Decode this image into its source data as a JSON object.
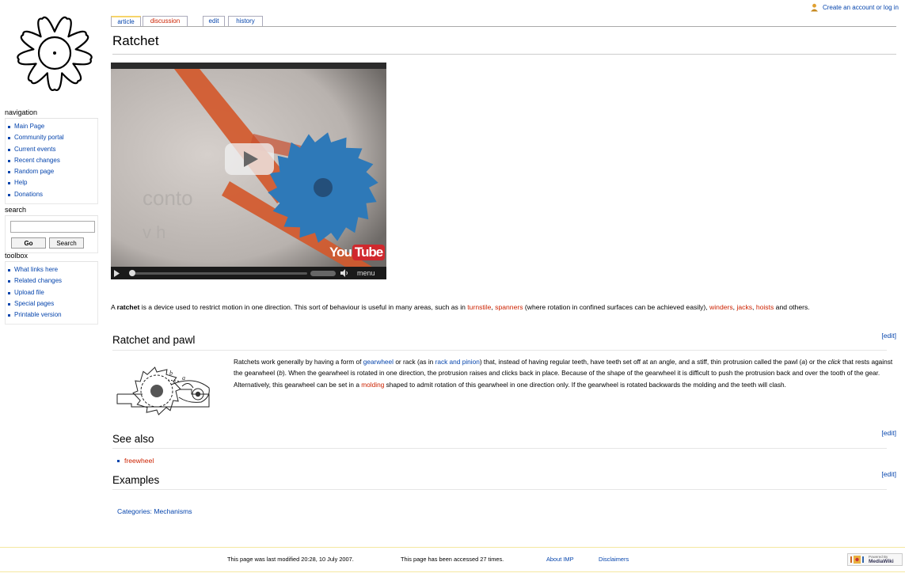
{
  "personal": {
    "login_label": "Create an account or log in"
  },
  "tabs": {
    "article": "article",
    "discussion": "discussion",
    "edit": "edit",
    "history": "history"
  },
  "sidebar": {
    "navigation": {
      "heading": "navigation",
      "items": [
        "Main Page",
        "Community portal",
        "Current events",
        "Recent changes",
        "Random page",
        "Help",
        "Donations"
      ]
    },
    "search": {
      "heading": "search",
      "value": "",
      "go_label": "Go",
      "search_label": "Search"
    },
    "toolbox": {
      "heading": "toolbox",
      "items": [
        "What links here",
        "Related changes",
        "Upload file",
        "Special pages",
        "Printable version"
      ]
    }
  },
  "content": {
    "title": "Ratchet",
    "video": {
      "brand_you": "You",
      "brand_tube": "Tube",
      "menu_label": "menu"
    },
    "intro": {
      "lead": "A ",
      "bold": "ratchet",
      "rest": " is a device used to restrict motion in one direction. This sort of behaviour is useful in many areas, such as in ",
      "link_turnstile": "turnstile",
      "sep1": ", ",
      "link_spanners": "spanners",
      "mid": " (where rotation in confined surfaces can be achieved easily), ",
      "link_winders": "winders",
      "sep2": ", ",
      "link_jacks": "jacks",
      "sep3": ", ",
      "link_hoists": "hoists",
      "end": " and others."
    },
    "edit_label": "[edit]",
    "sections": {
      "pawl": {
        "heading": "Ratchet and pawl",
        "fig_label_a": "a",
        "fig_label_b": "b",
        "t1": "Ratchets work generally by having a form of ",
        "link_gearwheel": "gearwheel",
        "t2": " or rack (as in ",
        "link_rack": "rack and pinion",
        "t3": ") that, instead of having regular teeth, have teeth set off at an angle, and a stiff, thin protrusion called the pawl (",
        "a": "a",
        "t4": ") or the ",
        "click": "click",
        "t5": " that rests against the gearwheel (",
        "b": "b",
        "t6": "). When the gearwheel is rotated in one direction, the protrusion raises and clicks back in place. Because of the shape of the gearwheel it is difficult to push the protrusion back and over the tooth of the gear. Alternatively, this gearwheel can be set in a ",
        "link_molding": "molding",
        "t7": " shaped to admit rotation of this gearwheel in one direction only. If the gearwheel is rotated backwards the molding and the teeth will clash."
      },
      "see_also": {
        "heading": "See also",
        "items": [
          "freewheel"
        ]
      },
      "examples": {
        "heading": "Examples"
      }
    },
    "categories": "Categories: Mechanisms"
  },
  "footer": {
    "last_modified": "This page was last modified 20:28, 10 July 2007.",
    "accessed": "This page has been accessed 27 times.",
    "about": "About IMP",
    "disclaimers": "Disclaimers",
    "powered_small": "Powered By",
    "powered_main": "MediaWiki"
  },
  "colors": {
    "link": "#0645ad",
    "new_link": "#cc2200",
    "tab_active_accent": "#f6d46a",
    "footer_rule": "#f4e8a0",
    "video_orange": "#d2592d",
    "video_blade": "#2e79b8"
  },
  "icons": [
    "sun-logo",
    "user-icon",
    "play-icon",
    "volume-icon",
    "mediawiki-logo"
  ]
}
